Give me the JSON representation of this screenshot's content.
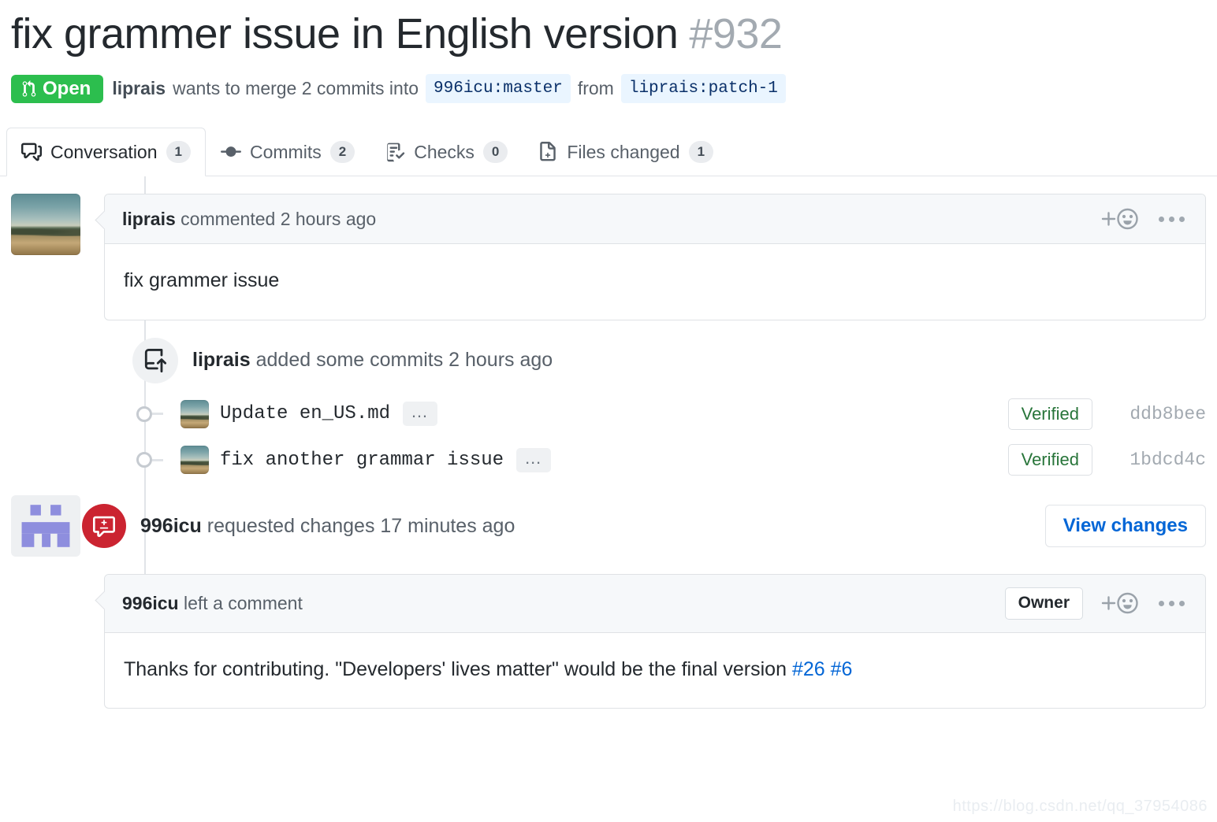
{
  "header": {
    "title": "fix grammer issue in English version",
    "number": "#932",
    "state_label": "Open",
    "state_color": "#2cbe4e",
    "author": "liprais",
    "merge_text_1": "wants to merge 2 commits into",
    "base_ref": "996icu:master",
    "merge_text_2": "from",
    "head_ref": "liprais:patch-1"
  },
  "tabs": [
    {
      "label": "Conversation",
      "count": "1",
      "icon": "comment-discussion-icon",
      "active": true
    },
    {
      "label": "Commits",
      "count": "2",
      "icon": "git-commit-icon",
      "active": false
    },
    {
      "label": "Checks",
      "count": "0",
      "icon": "checklist-icon",
      "active": false
    },
    {
      "label": "Files changed",
      "count": "1",
      "icon": "file-diff-icon",
      "active": false
    }
  ],
  "first_comment": {
    "author": "liprais",
    "meta": "commented 2 hours ago",
    "body": "fix grammer issue",
    "reaction_icon": "add-reaction-smiley-icon",
    "menu_icon": "kebab-horizontal-icon"
  },
  "commits_event": {
    "author": "liprais",
    "text": "added some commits 2 hours ago",
    "icon": "repo-push-icon",
    "commits": [
      {
        "message": "Update en_US.md",
        "verified_label": "Verified",
        "sha": "ddb8bee",
        "ellipsis": "…"
      },
      {
        "message": "fix another grammar issue",
        "verified_label": "Verified",
        "sha": "1bdcd4c",
        "ellipsis": "…"
      }
    ]
  },
  "review_event": {
    "author": "996icu",
    "text": "requested changes 17 minutes ago",
    "icon": "diff-review-icon",
    "button_label": "View changes"
  },
  "second_comment": {
    "author": "996icu",
    "meta": "left a comment",
    "owner_badge": "Owner",
    "body_text": "Thanks for contributing. \"Developers' lives matter\" would be the final version ",
    "link_1": "#26",
    "link_2": "#6",
    "reaction_icon": "add-reaction-smiley-icon",
    "menu_icon": "kebab-horizontal-icon"
  },
  "watermark": "https://blog.csdn.net/qq_37954086"
}
